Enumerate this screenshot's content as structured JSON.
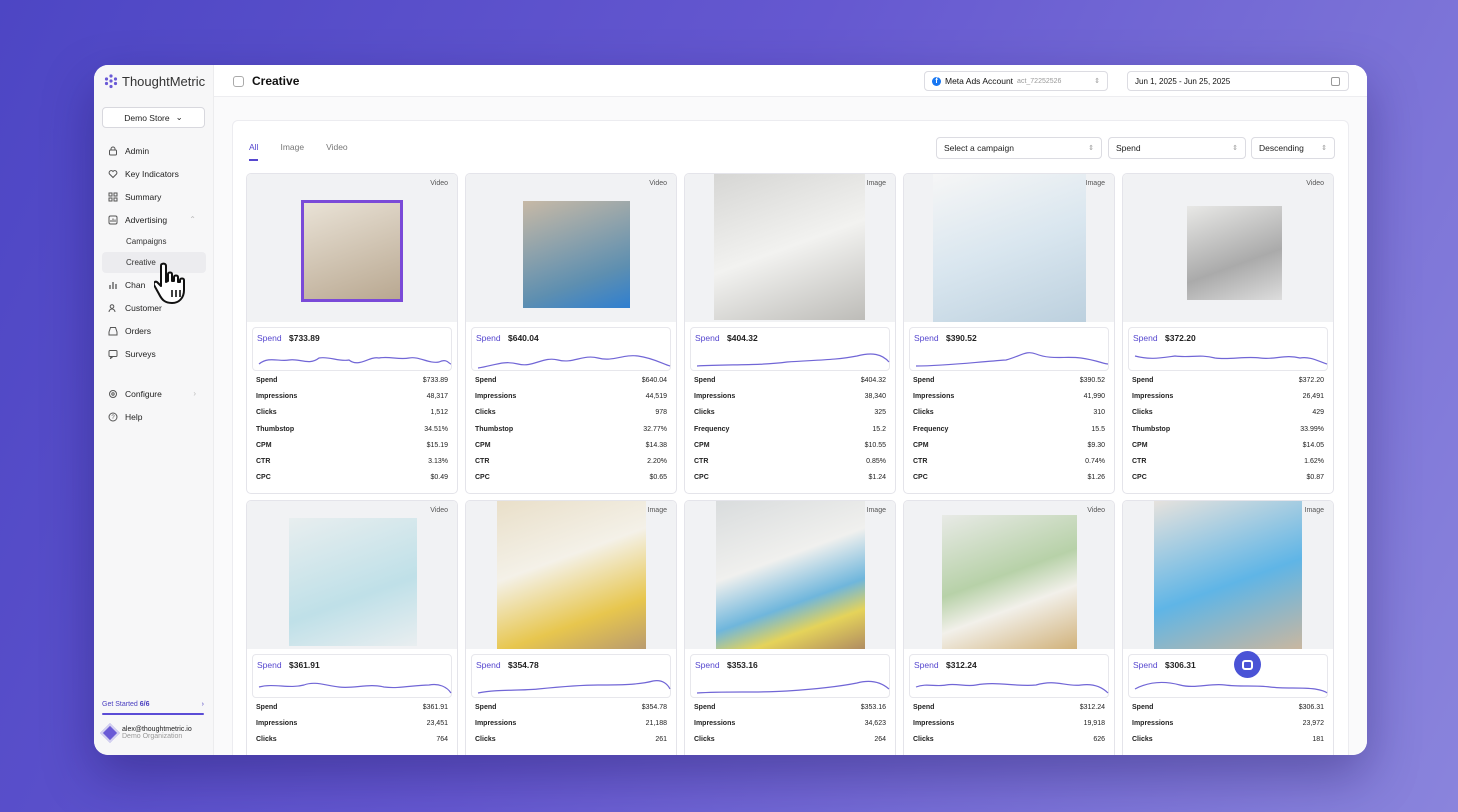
{
  "app": {
    "name": "ThoughtMetric"
  },
  "sidebar": {
    "store_label": "Demo Store",
    "items": [
      {
        "label": "Admin",
        "icon": "lock-icon"
      },
      {
        "label": "Key Indicators",
        "icon": "heart-icon"
      },
      {
        "label": "Summary",
        "icon": "grid-icon"
      },
      {
        "label": "Advertising",
        "icon": "chart-icon"
      },
      {
        "label": "Campaigns"
      },
      {
        "label": "Creative"
      },
      {
        "label": "Chan",
        "icon": "bars-icon"
      },
      {
        "label": "Customer",
        "icon": "users-icon"
      },
      {
        "label": "Orders",
        "icon": "inbox-icon"
      },
      {
        "label": "Surveys",
        "icon": "message-icon"
      },
      {
        "label": "Configure",
        "icon": "gear-icon"
      },
      {
        "label": "Help",
        "icon": "help-icon"
      }
    ],
    "get_started": "Get Started",
    "get_started_progress": "6/6",
    "user_email": "alex@thoughtmetric.io",
    "org": "Demo Organization"
  },
  "header": {
    "title": "Creative",
    "account_label": "Meta Ads Account",
    "account_id": "act_72252526",
    "date_range": "Jun 1, 2025 - Jun 25, 2025"
  },
  "tabs": [
    "All",
    "Image",
    "Video"
  ],
  "filters": {
    "campaign": "Select a campaign",
    "sort_by": "Spend",
    "order": "Descending"
  },
  "spend_label": "Spend",
  "cards": [
    {
      "type": "Video",
      "spend": "$733.89",
      "metrics": [
        [
          "Spend",
          "$733.89"
        ],
        [
          "Impressions",
          "48,317"
        ],
        [
          "Clicks",
          "1,512"
        ],
        [
          "Thumbstop",
          "34.51%"
        ],
        [
          "CPM",
          "$15.19"
        ],
        [
          "CTR",
          "3.13%"
        ],
        [
          "CPC",
          "$0.49"
        ]
      ]
    },
    {
      "type": "Video",
      "spend": "$640.04",
      "metrics": [
        [
          "Spend",
          "$640.04"
        ],
        [
          "Impressions",
          "44,519"
        ],
        [
          "Clicks",
          "978"
        ],
        [
          "Thumbstop",
          "32.77%"
        ],
        [
          "CPM",
          "$14.38"
        ],
        [
          "CTR",
          "2.20%"
        ],
        [
          "CPC",
          "$0.65"
        ]
      ]
    },
    {
      "type": "Image",
      "spend": "$404.32",
      "metrics": [
        [
          "Spend",
          "$404.32"
        ],
        [
          "Impressions",
          "38,340"
        ],
        [
          "Clicks",
          "325"
        ],
        [
          "Frequency",
          "15.2"
        ],
        [
          "CPM",
          "$10.55"
        ],
        [
          "CTR",
          "0.85%"
        ],
        [
          "CPC",
          "$1.24"
        ]
      ]
    },
    {
      "type": "Image",
      "spend": "$390.52",
      "metrics": [
        [
          "Spend",
          "$390.52"
        ],
        [
          "Impressions",
          "41,990"
        ],
        [
          "Clicks",
          "310"
        ],
        [
          "Frequency",
          "15.5"
        ],
        [
          "CPM",
          "$9.30"
        ],
        [
          "CTR",
          "0.74%"
        ],
        [
          "CPC",
          "$1.26"
        ]
      ]
    },
    {
      "type": "Video",
      "spend": "$372.20",
      "metrics": [
        [
          "Spend",
          "$372.20"
        ],
        [
          "Impressions",
          "26,491"
        ],
        [
          "Clicks",
          "429"
        ],
        [
          "Thumbstop",
          "33.99%"
        ],
        [
          "CPM",
          "$14.05"
        ],
        [
          "CTR",
          "1.62%"
        ],
        [
          "CPC",
          "$0.87"
        ]
      ]
    },
    {
      "type": "Video",
      "spend": "$361.91",
      "metrics": [
        [
          "Spend",
          "$361.91"
        ],
        [
          "Impressions",
          "23,451"
        ],
        [
          "Clicks",
          "764"
        ]
      ]
    },
    {
      "type": "Image",
      "spend": "$354.78",
      "metrics": [
        [
          "Spend",
          "$354.78"
        ],
        [
          "Impressions",
          "21,188"
        ],
        [
          "Clicks",
          "261"
        ]
      ]
    },
    {
      "type": "Image",
      "spend": "$353.16",
      "metrics": [
        [
          "Spend",
          "$353.16"
        ],
        [
          "Impressions",
          "34,623"
        ],
        [
          "Clicks",
          "264"
        ]
      ]
    },
    {
      "type": "Video",
      "spend": "$312.24",
      "metrics": [
        [
          "Spend",
          "$312.24"
        ],
        [
          "Impressions",
          "19,918"
        ],
        [
          "Clicks",
          "626"
        ]
      ]
    },
    {
      "type": "Image",
      "spend": "$306.31",
      "metrics": [
        [
          "Spend",
          "$306.31"
        ],
        [
          "Impressions",
          "23,972"
        ],
        [
          "Clicks",
          "181"
        ]
      ]
    }
  ]
}
